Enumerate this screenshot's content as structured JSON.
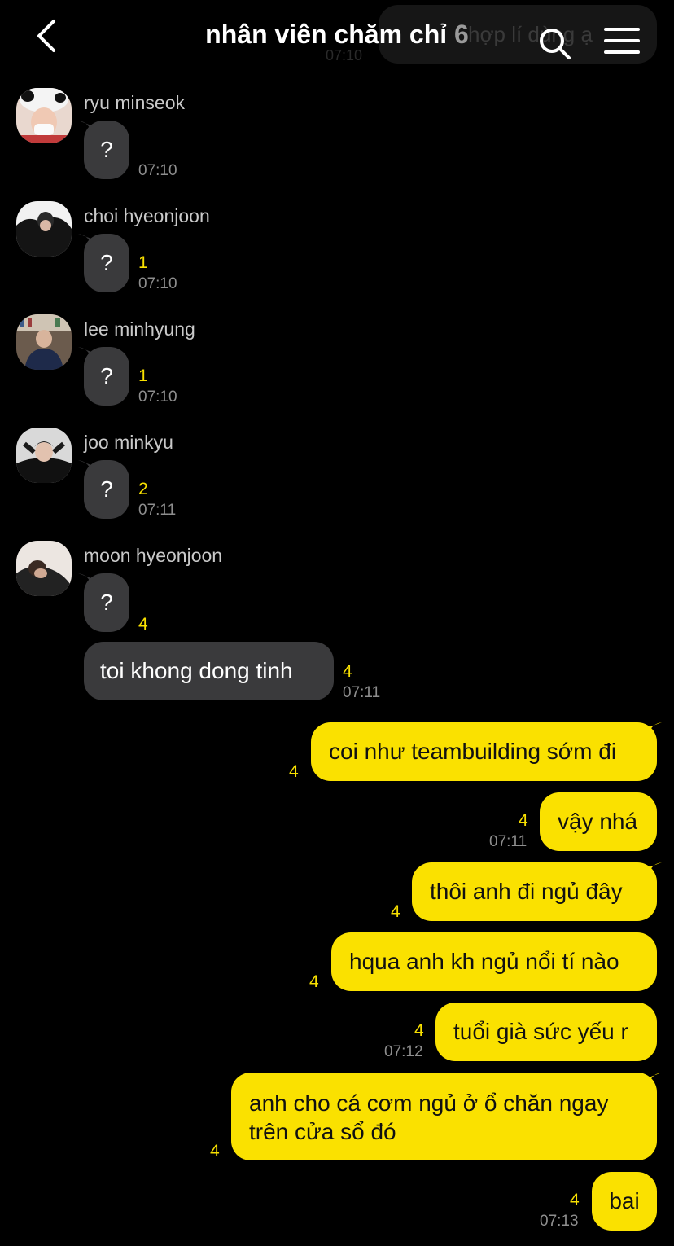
{
  "header": {
    "title": "nhân viên chăm chỉ",
    "member_count": "6",
    "ghost_preview_text": "hợp lí dùng ạ",
    "ghost_preview_time": "07:10"
  },
  "colors": {
    "my_bubble": "#fae100",
    "their_bubble": "#3a3a3c",
    "unread_count": "#f8e000",
    "background": "#000000"
  },
  "incoming": [
    {
      "sender": "ryu minseok",
      "text": "?",
      "count": "",
      "time": "07:10"
    },
    {
      "sender": "choi hyeonjoon",
      "text": "?",
      "count": "1",
      "time": "07:10"
    },
    {
      "sender": "lee minhyung",
      "text": "?",
      "count": "1",
      "time": "07:10"
    },
    {
      "sender": "joo minkyu",
      "text": "?",
      "count": "2",
      "time": "07:11"
    },
    {
      "sender": "moon hyeonjoon",
      "text": "?",
      "count": "4",
      "time": ""
    }
  ],
  "incoming_extra": {
    "text": "toi khong dong tinh",
    "count": "4",
    "time": "07:11"
  },
  "outgoing": [
    {
      "text": "coi như teambuilding sớm đi",
      "count": "4",
      "time": ""
    },
    {
      "text": "vậy nhá",
      "count": "4",
      "time": "07:11"
    },
    {
      "text": "thôi anh đi ngủ đây",
      "count": "4",
      "time": ""
    },
    {
      "text": "hqua anh kh ngủ nổi tí nào",
      "count": "4",
      "time": ""
    },
    {
      "text": "tuổi già sức yếu r",
      "count": "4",
      "time": "07:12"
    },
    {
      "text_line1": "anh cho cá cơm ngủ ở ổ chăn ngay",
      "text_line2": "trên cửa sổ đó",
      "count": "4",
      "time": ""
    },
    {
      "text": "bai",
      "count": "4",
      "time": "07:13"
    }
  ]
}
